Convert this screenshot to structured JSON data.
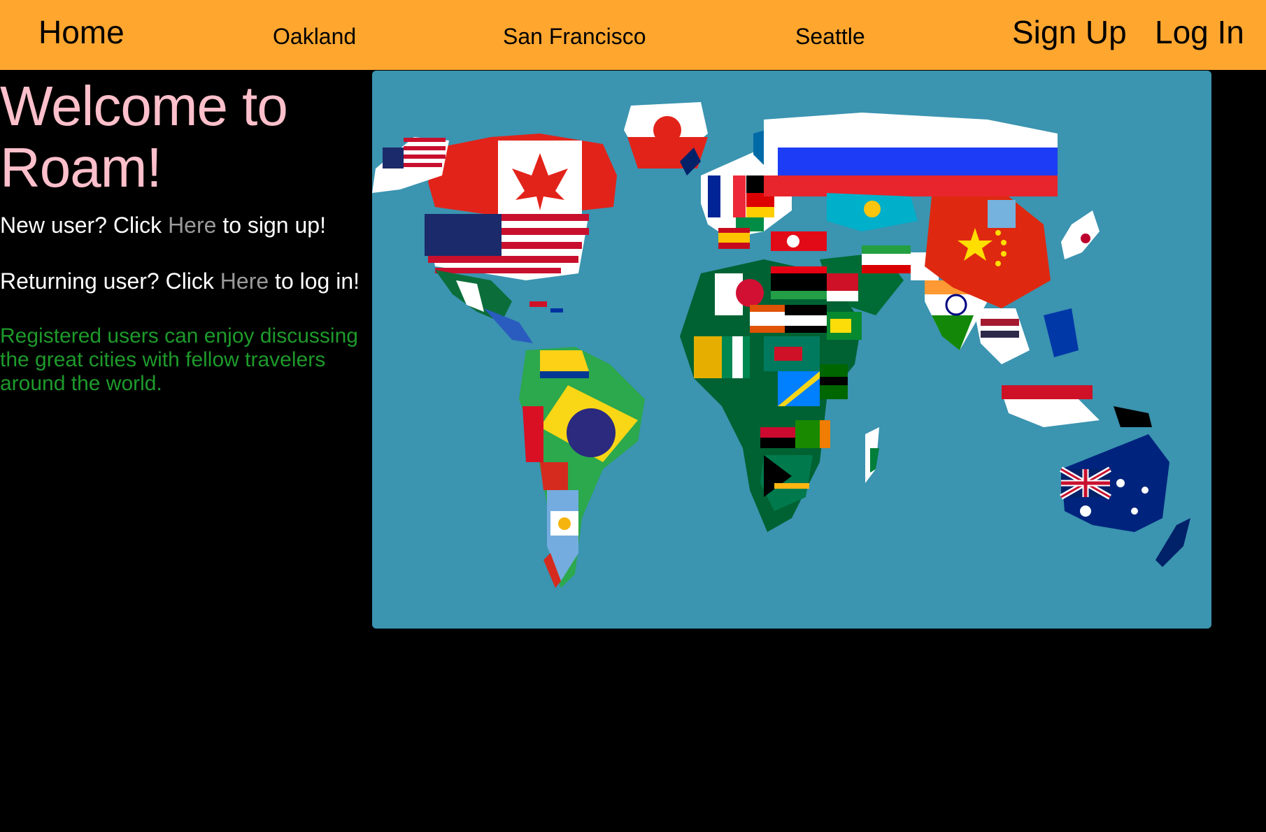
{
  "nav": {
    "home": "Home",
    "cities": [
      "Oakland",
      "San Francisco",
      "Seattle"
    ],
    "sign_up": "Sign Up",
    "log_in": "Log In"
  },
  "hero": {
    "title_line1": "Welcome to",
    "title_line2": "Roam!",
    "new_user_prefix": "New user? Click ",
    "new_user_link": "Here",
    "new_user_suffix": " to sign up!",
    "returning_prefix": "Returning user? Click ",
    "returning_link": "Here",
    "returning_suffix": " to log in!",
    "promo": "Registered users can enjoy discussing the great cities with fellow travelers around the world."
  },
  "map": {
    "description_icon": "world-flag-map",
    "ocean_color": "#3b94b0"
  },
  "colors": {
    "navbar": "#ffa62f",
    "title": "#ffc0cb",
    "link": "#9a9a9a",
    "promo": "#1e9a2b"
  }
}
